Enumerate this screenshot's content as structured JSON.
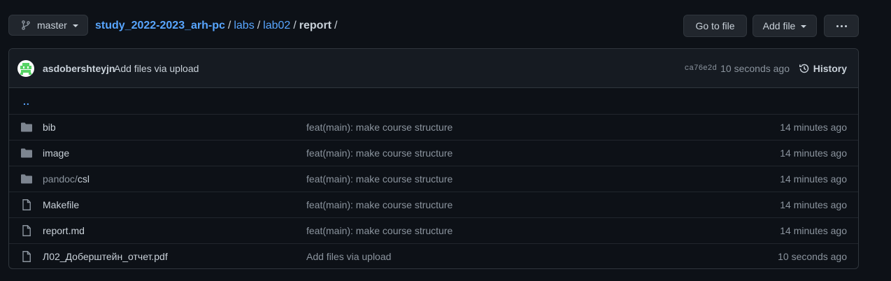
{
  "toolbar": {
    "branch": "master",
    "go_to_file": "Go to file",
    "add_file": "Add file"
  },
  "breadcrumb": {
    "repo": "study_2022-2023_arh-pc",
    "sep": "/",
    "parts": [
      "labs",
      "lab02"
    ],
    "current": "report"
  },
  "commit": {
    "author": "asdobershteyjn",
    "message": "Add files via upload",
    "sha": "ca76e2d",
    "time": "10 seconds ago",
    "history_label": "History"
  },
  "files": {
    "parent_dir": "..",
    "rows": [
      {
        "type": "folder",
        "name": "bib",
        "message": "feat(main): make course structure",
        "time": "14 minutes ago"
      },
      {
        "type": "folder",
        "name": "image",
        "message": "feat(main): make course structure",
        "time": "14 minutes ago"
      },
      {
        "type": "folder",
        "name_prefix": "pandoc/",
        "name": "csl",
        "message": "feat(main): make course structure",
        "time": "14 minutes ago"
      },
      {
        "type": "file",
        "name": "Makefile",
        "message": "feat(main): make course structure",
        "time": "14 minutes ago"
      },
      {
        "type": "file",
        "name": "report.md",
        "message": "feat(main): make course structure",
        "time": "14 minutes ago"
      },
      {
        "type": "file",
        "name": "Л02_Доберштейн_отчет.pdf",
        "message": "Add files via upload",
        "time": "10 seconds ago"
      }
    ]
  },
  "colors": {
    "background": "#0d1117",
    "link": "#58a6ff",
    "muted": "#8b949e",
    "folder_icon": "#7d8590",
    "avatar_accent": "#56d364"
  }
}
